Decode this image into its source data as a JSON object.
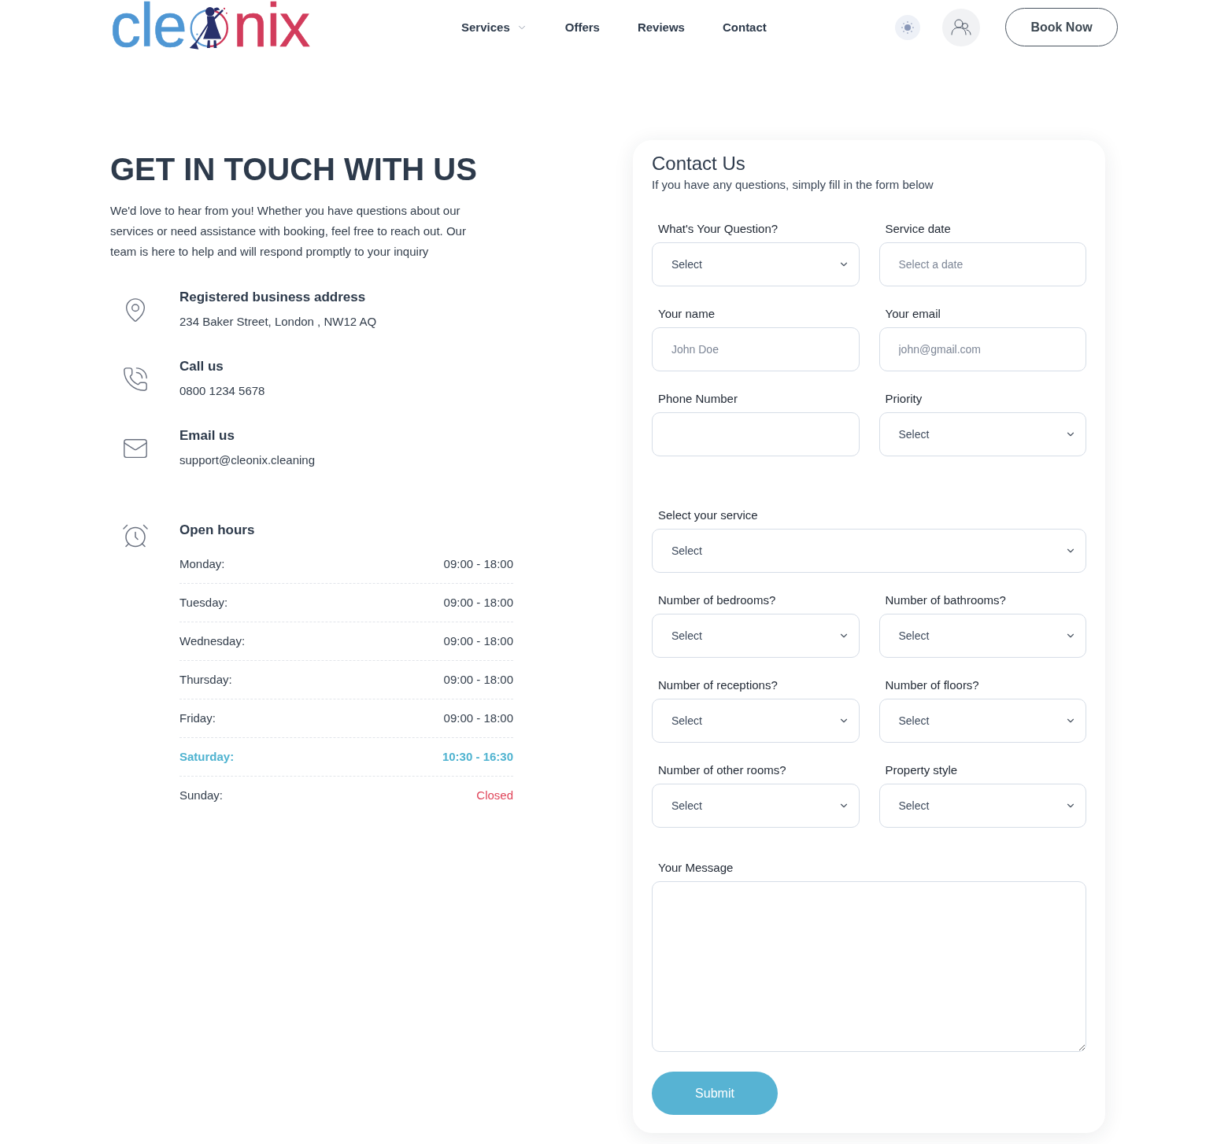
{
  "header": {
    "logo": {
      "start": "cle",
      "end": "nix"
    },
    "nav": [
      {
        "label": "Services",
        "dropdown": true
      },
      {
        "label": "Offers",
        "dropdown": false
      },
      {
        "label": "Reviews",
        "dropdown": false
      },
      {
        "label": "Contact",
        "dropdown": false
      }
    ],
    "book_button": "Book Now"
  },
  "intro": {
    "heading": "GET IN TOUCH WITH US",
    "text": "We'd love to hear from you! Whether you have questions about our services or need assistance with booking, feel free to reach out. Our team is here to help and will respond promptly to your inquiry"
  },
  "contacts": [
    {
      "kind": "address",
      "title": "Registered business address",
      "value": "234 Baker Street, London , NW12 AQ"
    },
    {
      "kind": "phone",
      "title": "Call us",
      "value": "0800 1234 5678"
    },
    {
      "kind": "email",
      "title": "Email us",
      "value": "support@cleonix.cleaning"
    }
  ],
  "hours": {
    "title": "Open hours",
    "days": [
      {
        "day": "Monday:",
        "time": "09:00 - 18:00",
        "selected": false,
        "closed": false
      },
      {
        "day": "Tuesday:",
        "time": "09:00 - 18:00",
        "selected": false,
        "closed": false
      },
      {
        "day": "Wednesday:",
        "time": "09:00 - 18:00",
        "selected": false,
        "closed": false
      },
      {
        "day": "Thursday:",
        "time": "09:00 - 18:00",
        "selected": false,
        "closed": false
      },
      {
        "day": "Friday:",
        "time": "09:00 - 18:00",
        "selected": false,
        "closed": false
      },
      {
        "day": "Saturday:",
        "time": "10:30 - 16:30",
        "selected": true,
        "closed": false
      },
      {
        "day": "Sunday:",
        "time": "Closed",
        "selected": false,
        "closed": true
      }
    ]
  },
  "contact_form": {
    "title": "Contact Us",
    "subtitle": "If you have any questions, simply fill in the form below",
    "rows": [
      {
        "fields": [
          {
            "kind": "select",
            "label": "What's Your Question?",
            "value": "Select"
          },
          {
            "kind": "date",
            "label": "Service date",
            "placeholder": "Select a date"
          }
        ]
      },
      {
        "fields": [
          {
            "kind": "text",
            "label": "Your name",
            "placeholder": "John Doe"
          },
          {
            "kind": "text",
            "label": "Your email",
            "placeholder": "john@gmail.com"
          }
        ]
      },
      {
        "fields": [
          {
            "kind": "text",
            "label": "Phone Number"
          },
          {
            "kind": "select",
            "label": "Priority",
            "value": "Select"
          }
        ]
      },
      {
        "fields": [
          {
            "kind": "select",
            "label": "Select your service",
            "value": "Select"
          }
        ]
      },
      {
        "fields": [
          {
            "kind": "select",
            "label": "Number of bedrooms?",
            "value": "Select"
          },
          {
            "kind": "select",
            "label": "Number of bathrooms?",
            "value": "Select"
          }
        ]
      },
      {
        "fields": [
          {
            "kind": "select",
            "label": "Number of receptions?",
            "value": "Select"
          },
          {
            "kind": "select",
            "label": "Number of floors?",
            "value": "Select"
          }
        ]
      },
      {
        "fields": [
          {
            "kind": "select",
            "label": "Number of other rooms?",
            "value": "Select"
          },
          {
            "kind": "select",
            "label": "Property style",
            "value": "Select"
          }
        ]
      },
      {
        "fields": [
          {
            "kind": "textarea",
            "label": "Your Message"
          }
        ]
      }
    ],
    "submit": "Submit"
  }
}
